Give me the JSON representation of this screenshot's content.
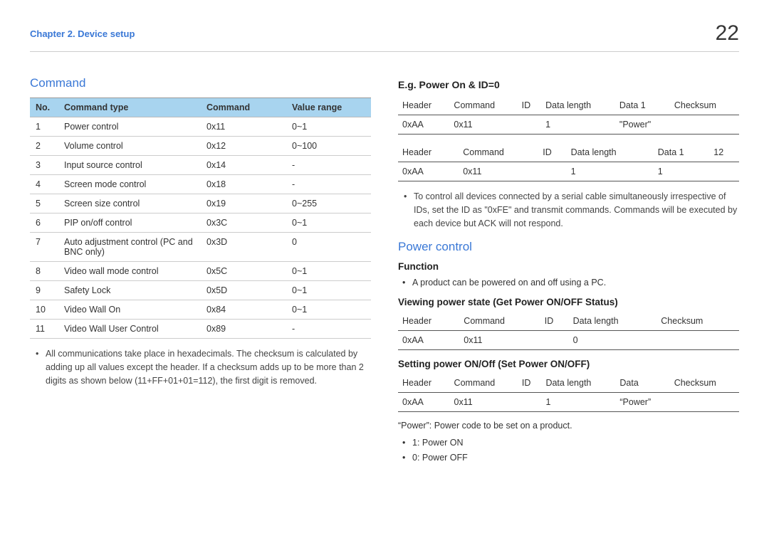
{
  "header": {
    "chapter": "Chapter 2. Device setup",
    "page": "22"
  },
  "left": {
    "title": "Command",
    "table": {
      "headers": {
        "no": "No.",
        "type": "Command type",
        "cmd": "Command",
        "range": "Value range"
      },
      "rows": [
        {
          "no": "1",
          "type": "Power control",
          "cmd": "0x11",
          "range": "0~1"
        },
        {
          "no": "2",
          "type": "Volume control",
          "cmd": "0x12",
          "range": "0~100"
        },
        {
          "no": "3",
          "type": "Input source control",
          "cmd": "0x14",
          "range": "-"
        },
        {
          "no": "4",
          "type": "Screen mode control",
          "cmd": "0x18",
          "range": "-"
        },
        {
          "no": "5",
          "type": "Screen size control",
          "cmd": "0x19",
          "range": "0~255"
        },
        {
          "no": "6",
          "type": "PIP on/off control",
          "cmd": "0x3C",
          "range": "0~1"
        },
        {
          "no": "7",
          "type": "Auto adjustment control (PC and BNC only)",
          "cmd": "0x3D",
          "range": "0"
        },
        {
          "no": "8",
          "type": "Video wall mode control",
          "cmd": "0x5C",
          "range": "0~1"
        },
        {
          "no": "9",
          "type": "Safety Lock",
          "cmd": "0x5D",
          "range": "0~1"
        },
        {
          "no": "10",
          "type": "Video Wall On",
          "cmd": "0x84",
          "range": "0~1"
        },
        {
          "no": "11",
          "type": "Video Wall User Control",
          "cmd": "0x89",
          "range": "-"
        }
      ]
    },
    "note": "All communications take place in hexadecimals. The checksum is calculated by adding up all values except the header. If a checksum adds up to be more than 2 digits as shown below (11+FF+01+01=112), the first digit is removed."
  },
  "right": {
    "eg_title": "E.g. Power On & ID=0",
    "eg_table1": {
      "h": [
        "Header",
        "Command",
        "ID",
        "Data length",
        "Data 1",
        "Checksum"
      ],
      "r": [
        "0xAA",
        "0x11",
        "",
        "1",
        "\"Power\"",
        ""
      ]
    },
    "eg_table2": {
      "h": [
        "Header",
        "Command",
        "ID",
        "Data length",
        "Data 1",
        "12"
      ],
      "r": [
        "0xAA",
        "0x11",
        "",
        "1",
        "1",
        ""
      ]
    },
    "eg_note": "To control all devices connected by a serial cable simultaneously irrespective of IDs, set the ID as \"0xFE\" and transmit commands. Commands will be executed by each device but ACK will not respond.",
    "power_title": "Power control",
    "func_title": "Function",
    "func_bullet": "A product can be powered on and off using a PC.",
    "view_title": "Viewing power state (Get Power ON/OFF Status)",
    "view_table": {
      "h": [
        "Header",
        "Command",
        "ID",
        "Data length",
        "Checksum"
      ],
      "r": [
        "0xAA",
        "0x11",
        "",
        "0",
        ""
      ]
    },
    "set_title": "Setting power ON/Off (Set Power ON/OFF)",
    "set_table": {
      "h": [
        "Header",
        "Command",
        "ID",
        "Data length",
        "Data",
        "Checksum"
      ],
      "r": [
        "0xAA",
        "0x11",
        "",
        "1",
        "“Power”",
        ""
      ]
    },
    "power_code_line": "“Power”: Power code to be set on a product.",
    "power_on": "1: Power ON",
    "power_off": "0: Power OFF"
  }
}
